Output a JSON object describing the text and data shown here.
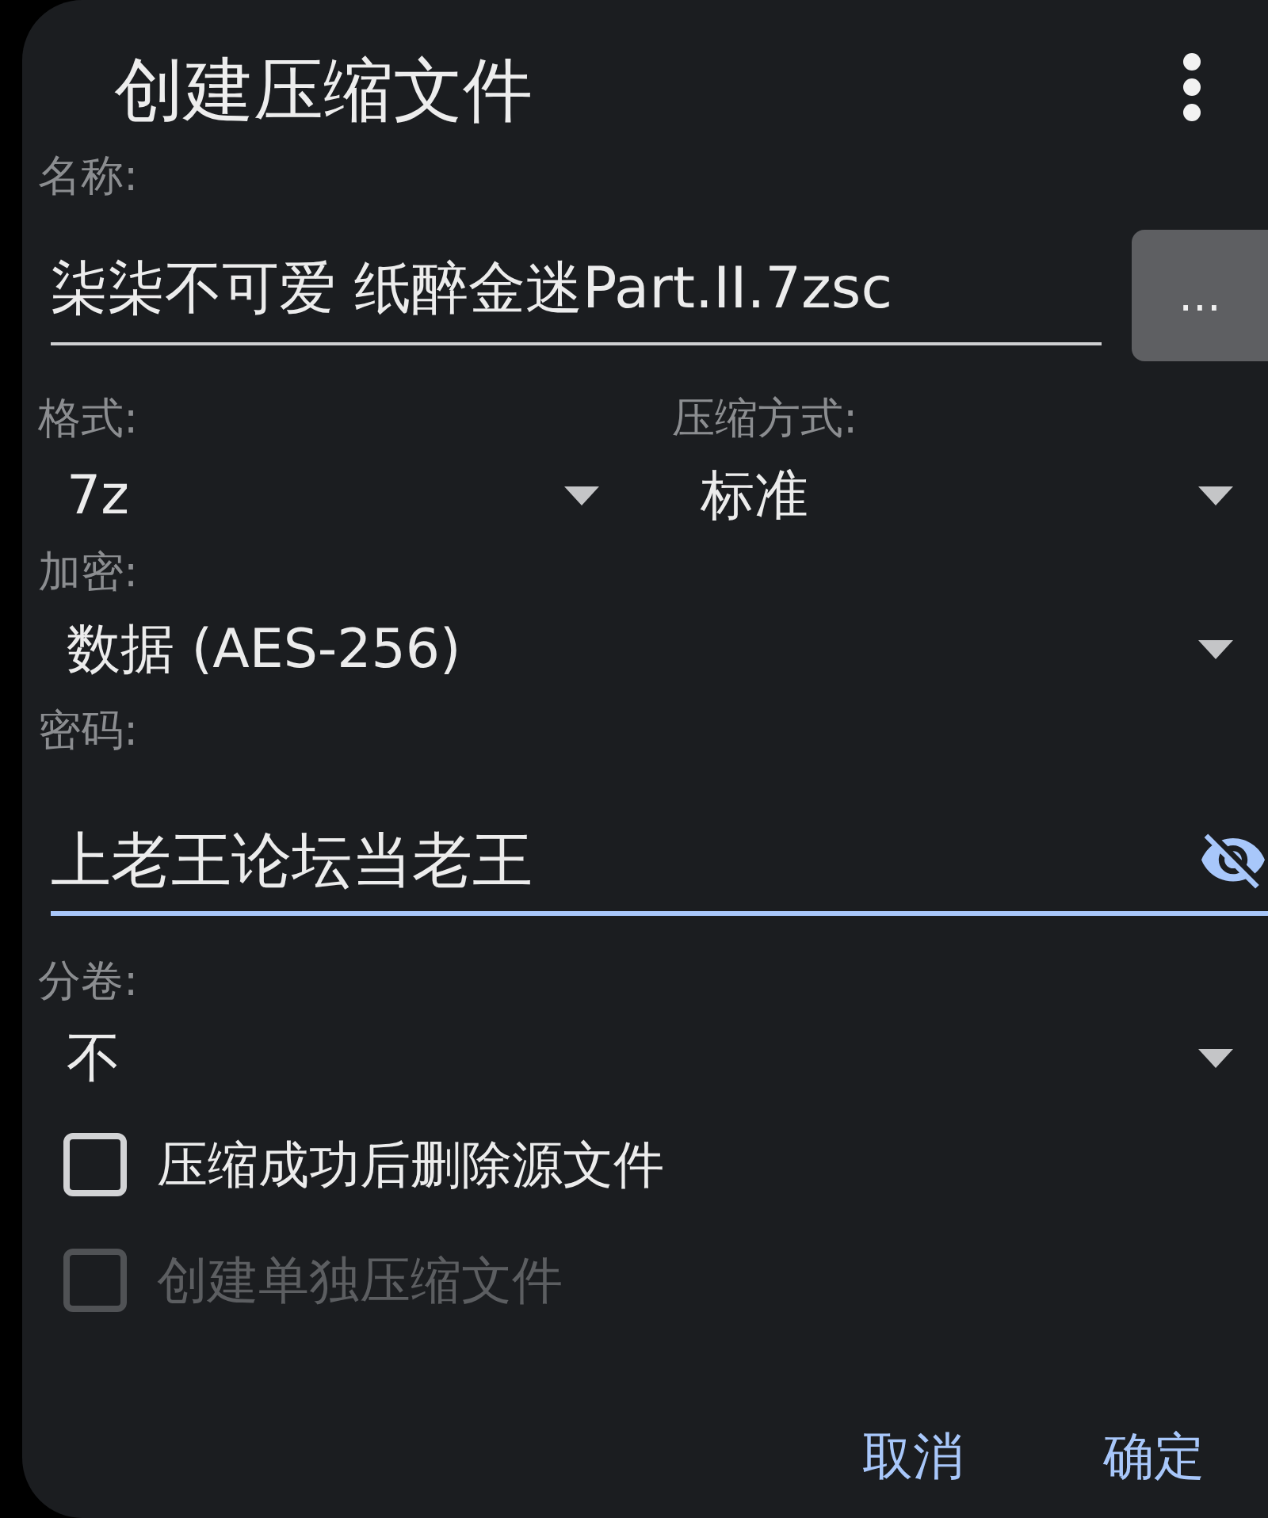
{
  "dialog": {
    "title": "创建压缩文件"
  },
  "name": {
    "label": "名称:",
    "value": "柒柒不可爱 纸醉金迷Part.II.7zsc",
    "focused": false,
    "browse_button": "..."
  },
  "format": {
    "label": "格式:",
    "value": "7z"
  },
  "compression": {
    "label": "压缩方式:",
    "value": "标准"
  },
  "encryption": {
    "label": "加密:",
    "value": "数据 (AES-256)"
  },
  "password": {
    "label": "密码:",
    "value": "上老王论坛当老王",
    "focused": true
  },
  "split": {
    "label": "分卷:",
    "value": "不"
  },
  "checkboxes": [
    {
      "label": "压缩成功后删除源文件",
      "checked": false,
      "disabled": false
    },
    {
      "label": "创建单独压缩文件",
      "checked": false,
      "disabled": true
    }
  ],
  "buttons": [
    {
      "label": "取消"
    },
    {
      "label": "确定"
    }
  ]
}
